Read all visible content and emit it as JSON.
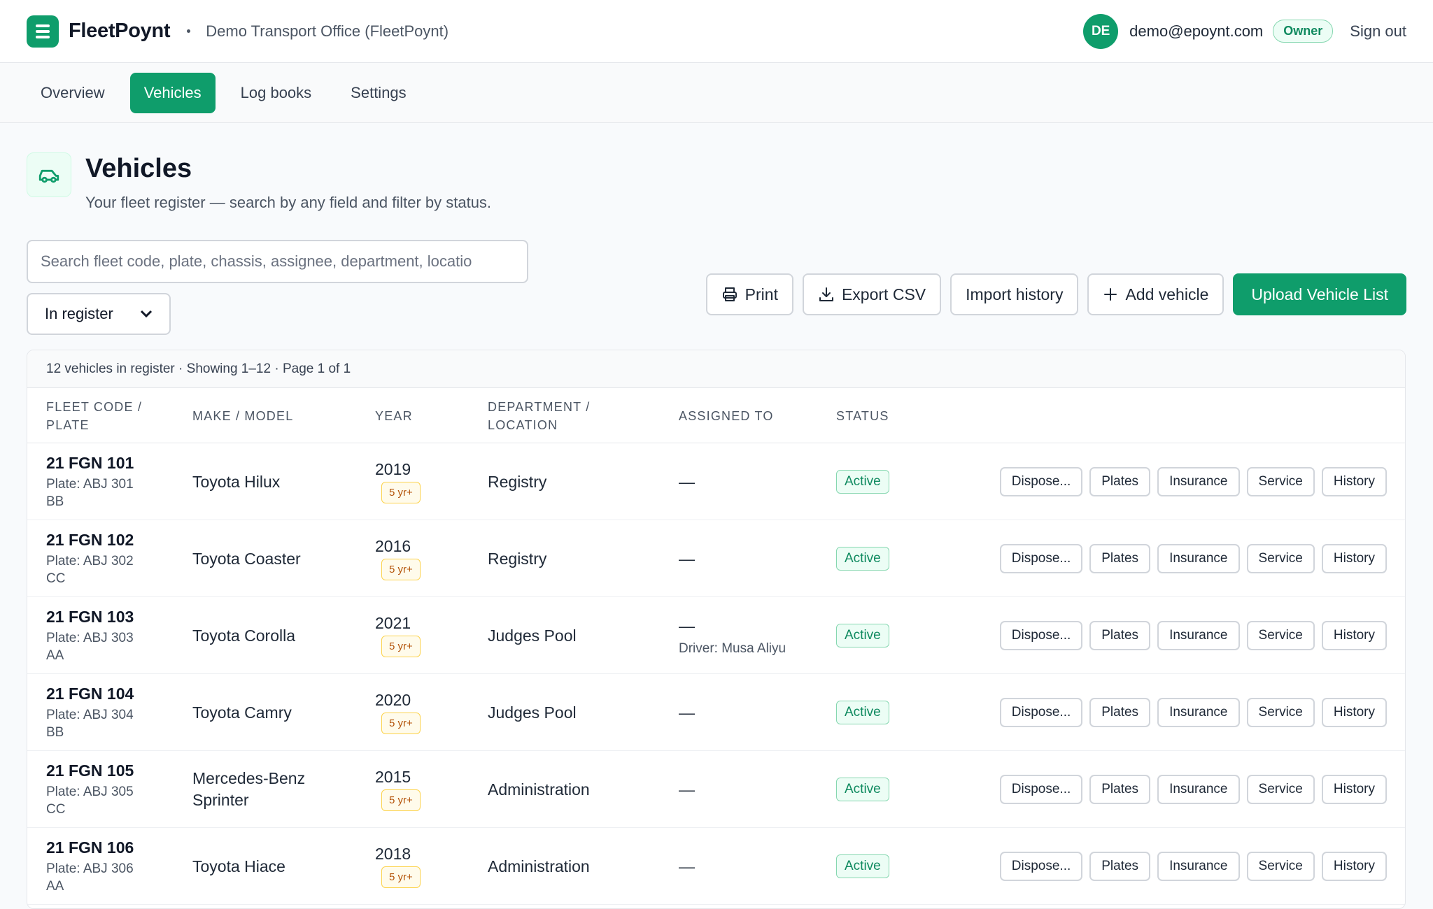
{
  "header": {
    "brand": "FleetPoynt",
    "org": "Demo Transport Office (FleetPoynt)",
    "avatar_initials": "DE",
    "email": "demo@epoynt.com",
    "role": "Owner",
    "signout": "Sign out"
  },
  "tabs": [
    {
      "label": "Overview",
      "active": false
    },
    {
      "label": "Vehicles",
      "active": true
    },
    {
      "label": "Log books",
      "active": false
    },
    {
      "label": "Settings",
      "active": false
    }
  ],
  "page": {
    "title": "Vehicles",
    "subtitle": "Your fleet register — search by any field and filter by status."
  },
  "search": {
    "placeholder": "Search fleet code, plate, chassis, assignee, department, locatio",
    "value": ""
  },
  "filter": {
    "selected": "In register"
  },
  "actions": {
    "print": "Print",
    "export": "Export CSV",
    "import_history": "Import history",
    "add": "Add vehicle",
    "upload": "Upload Vehicle List"
  },
  "table": {
    "summary": "12 vehicles in register · Showing 1–12 · Page 1 of 1",
    "headers": {
      "fleet_code_1": "FLEET CODE /",
      "fleet_code_2": "PLATE",
      "make_model": "MAKE / MODEL",
      "year": "YEAR",
      "dept_1": "DEPARTMENT /",
      "dept_2": "LOCATION",
      "assigned": "ASSIGNED TO",
      "status": "STATUS"
    },
    "row_actions": [
      "Dispose...",
      "Plates",
      "Insurance",
      "Service",
      "History"
    ],
    "rows": [
      {
        "code": "21 FGN 101",
        "plate": "Plate: ABJ 301 BB",
        "model": "Toyota Hilux",
        "year": "2019",
        "age": "5 yr+",
        "dept": "Registry",
        "assigned": "—",
        "driver": "",
        "status": "Active"
      },
      {
        "code": "21 FGN 102",
        "plate": "Plate: ABJ 302 CC",
        "model": "Toyota Coaster",
        "year": "2016",
        "age": "5 yr+",
        "dept": "Registry",
        "assigned": "—",
        "driver": "",
        "status": "Active"
      },
      {
        "code": "21 FGN 103",
        "plate": "Plate: ABJ 303 AA",
        "model": "Toyota Corolla",
        "year": "2021",
        "age": "5 yr+",
        "dept": "Judges Pool",
        "assigned": "—",
        "driver": "Driver: Musa Aliyu",
        "status": "Active"
      },
      {
        "code": "21 FGN 104",
        "plate": "Plate: ABJ 304 BB",
        "model": "Toyota Camry",
        "year": "2020",
        "age": "5 yr+",
        "dept": "Judges Pool",
        "assigned": "—",
        "driver": "",
        "status": "Active"
      },
      {
        "code": "21 FGN 105",
        "plate": "Plate: ABJ 305 CC",
        "model": "Mercedes-Benz Sprinter",
        "year": "2015",
        "age": "5 yr+",
        "dept": "Administration",
        "assigned": "—",
        "driver": "",
        "status": "Active"
      },
      {
        "code": "21 FGN 106",
        "plate": "Plate: ABJ 306 AA",
        "model": "Toyota Hiace",
        "year": "2018",
        "age": "5 yr+",
        "dept": "Administration",
        "assigned": "—",
        "driver": "",
        "status": "Active"
      }
    ]
  }
}
